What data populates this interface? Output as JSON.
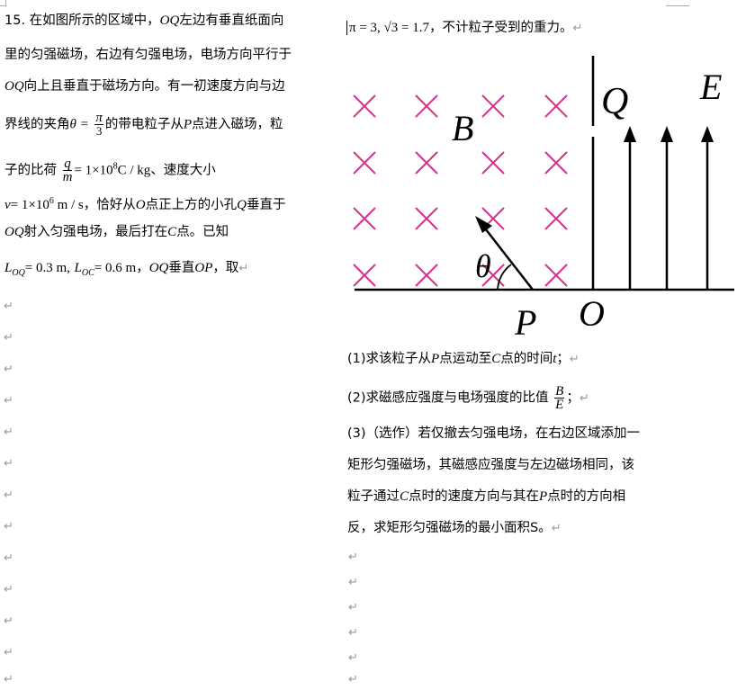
{
  "left": {
    "q_num": "15.",
    "l1a": "在如图所示的区域中，",
    "l1b": "OQ",
    "l1c": "左边有垂直纸面向",
    "l2": "里的匀强磁场，右边有匀强电场，电场方向平行于",
    "l3a": "OQ",
    "l3b": "向上且垂直于磁场方向。有一初速度方向与边",
    "l4a": "界线的夹角",
    "l4_theta": "θ =",
    "l4_num": "π",
    "l4_den": "3",
    "l4b": "的带电粒子从",
    "l4_P": "P",
    "l4c": "点进入磁场，粒",
    "l5a": "子的比荷",
    "l5_num": "q",
    "l5_den": "m",
    "l5_val": "= 1×10",
    "l5_exp": "8",
    "l5_unit": "C / kg",
    "l5b": "、速度大小",
    "l6_v": "v",
    "l6_val": "= 1×10",
    "l6_exp": "6",
    "l6_unit": " m / s",
    "l6a": "，恰好从",
    "l6_O": "O",
    "l6b": "点正上方的小孔",
    "l6_Q": "Q",
    "l6c": "垂直于",
    "l7a": "OQ",
    "l7b": "射入匀强电场，最后打在",
    "l7_C": "C",
    "l7c": "点。已知",
    "l8_L1": "L",
    "l8_s1": "OQ",
    "l8_v1": "= 0.3 m,",
    "l8_L2": "L",
    "l8_s2": "OC",
    "l8_v2": "= 0.6 m",
    "l8a": "，",
    "l8_OQ": "OQ",
    "l8b": "垂直",
    "l8_OP": "OP",
    "l8c": "，取"
  },
  "right": {
    "top_math": "π = 3, √3 = 1.7",
    "top_text": "，不计粒子受到的重力。",
    "q1a": "(1)求该粒子从",
    "q1_P": "P",
    "q1b": "点运动至",
    "q1_C": "C",
    "q1c": "点的时间",
    "q1_t": "t",
    "q1d": "；",
    "q2a": "(2)求磁感应强度与电场强度的比值",
    "q2_num": "B",
    "q2_den": "E",
    "q2b": "；",
    "q3_l1": "(3)（选作）若仅撤去匀强电场，在右边区域添加一",
    "q3_l2": "矩形匀强磁场，其磁感应强度与左边磁场相同，该",
    "q3_l3a": "粒子通过",
    "q3_C": "C",
    "q3_l3b": "点时的速度方向与其在",
    "q3_P": "P",
    "q3_l3c": "点时的方向相",
    "q3_l4": "反，求矩形匀强磁场的最小面积S。"
  },
  "figure": {
    "label_B": "B",
    "label_Q": "Q",
    "label_E": "E",
    "label_theta": "θ",
    "label_P": "P",
    "label_O": "O",
    "cross_color": "#d4338a"
  },
  "return_mark": "↵"
}
